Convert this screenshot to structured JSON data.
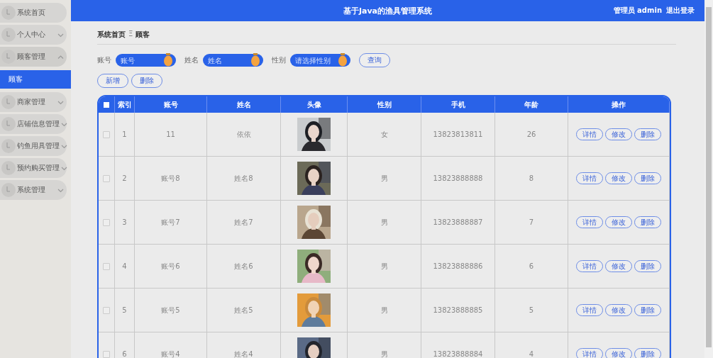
{
  "header": {
    "title": "基于Java的渔具管理系统",
    "user": "管理员 admin",
    "logout": "退出登录"
  },
  "sidebar": {
    "items": [
      {
        "label": "系统首页"
      },
      {
        "label": "个人中心",
        "expanded": false
      },
      {
        "label": "顾客管理",
        "expanded": true,
        "children": [
          {
            "label": "顾客",
            "selected": true
          }
        ]
      },
      {
        "label": "商家管理",
        "expanded": false
      },
      {
        "label": "店铺信息管理",
        "expanded": false
      },
      {
        "label": "钓鱼用具管理",
        "expanded": false
      },
      {
        "label": "预约购买管理",
        "expanded": false
      },
      {
        "label": "系统管理",
        "expanded": false
      }
    ]
  },
  "breadcrumb": {
    "items": [
      "系统首页",
      "顾客"
    ],
    "separator": "Ξ"
  },
  "search": {
    "fields": [
      {
        "label": "账号",
        "placeholder": "账号"
      },
      {
        "label": "姓名",
        "placeholder": "姓名"
      },
      {
        "label": "性别",
        "placeholder": "请选择性别"
      }
    ],
    "button": "查询"
  },
  "actions": [
    "新增",
    "删除"
  ],
  "table": {
    "select_all_checked": false,
    "columns": [
      "索引",
      "账号",
      "姓名",
      "头像",
      "性别",
      "手机",
      "年龄",
      "操作"
    ],
    "rows": [
      {
        "checked": false,
        "index": "1",
        "account": "11",
        "name": "依依",
        "gender": "女",
        "phone": "13823813811",
        "age": "26",
        "actions": [
          "详情",
          "修改",
          "删除"
        ]
      },
      {
        "checked": false,
        "index": "2",
        "account": "账号8",
        "name": "姓名8",
        "gender": "男",
        "phone": "13823888888",
        "age": "8",
        "actions": [
          "详情",
          "修改",
          "删除"
        ]
      },
      {
        "checked": false,
        "index": "3",
        "account": "账号7",
        "name": "姓名7",
        "gender": "男",
        "phone": "13823888887",
        "age": "7",
        "actions": [
          "详情",
          "修改",
          "删除"
        ]
      },
      {
        "checked": false,
        "index": "4",
        "account": "账号6",
        "name": "姓名6",
        "gender": "男",
        "phone": "13823888886",
        "age": "6",
        "actions": [
          "详情",
          "修改",
          "删除"
        ]
      },
      {
        "checked": false,
        "index": "5",
        "account": "账号5",
        "name": "姓名5",
        "gender": "男",
        "phone": "13823888885",
        "age": "5",
        "actions": [
          "详情",
          "修改",
          "删除"
        ]
      },
      {
        "checked": false,
        "index": "6",
        "account": "账号4",
        "name": "姓名4",
        "gender": "男",
        "phone": "13823888884",
        "age": "4",
        "actions": [
          "详情",
          "修改",
          "删除"
        ]
      }
    ]
  }
}
